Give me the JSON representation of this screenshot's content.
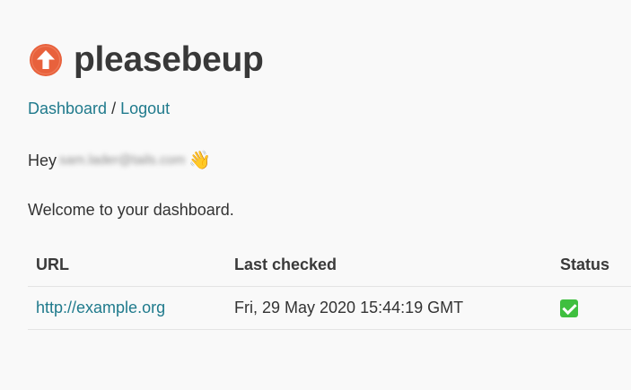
{
  "brand": {
    "title": "pleasebeup",
    "logo_icon": "arrow-up-circle-icon",
    "logo_color": "#e8613c"
  },
  "nav": {
    "dashboard_label": "Dashboard",
    "separator": " / ",
    "logout_label": "Logout"
  },
  "greeting": {
    "prefix": "Hey",
    "email": "sam.lader@tails.com",
    "emoji": "👋"
  },
  "welcome_text": "Welcome to your dashboard.",
  "table": {
    "headers": {
      "url": "URL",
      "last_checked": "Last checked",
      "status": "Status"
    },
    "rows": [
      {
        "url": "http://example.org",
        "last_checked": "Fri, 29 May 2020 15:44:19 GMT",
        "status_icon": "check-mark-icon"
      }
    ]
  },
  "colors": {
    "link": "#1f7a8c",
    "background": "#f9f9f9",
    "status_ok": "#3fbf3f"
  }
}
